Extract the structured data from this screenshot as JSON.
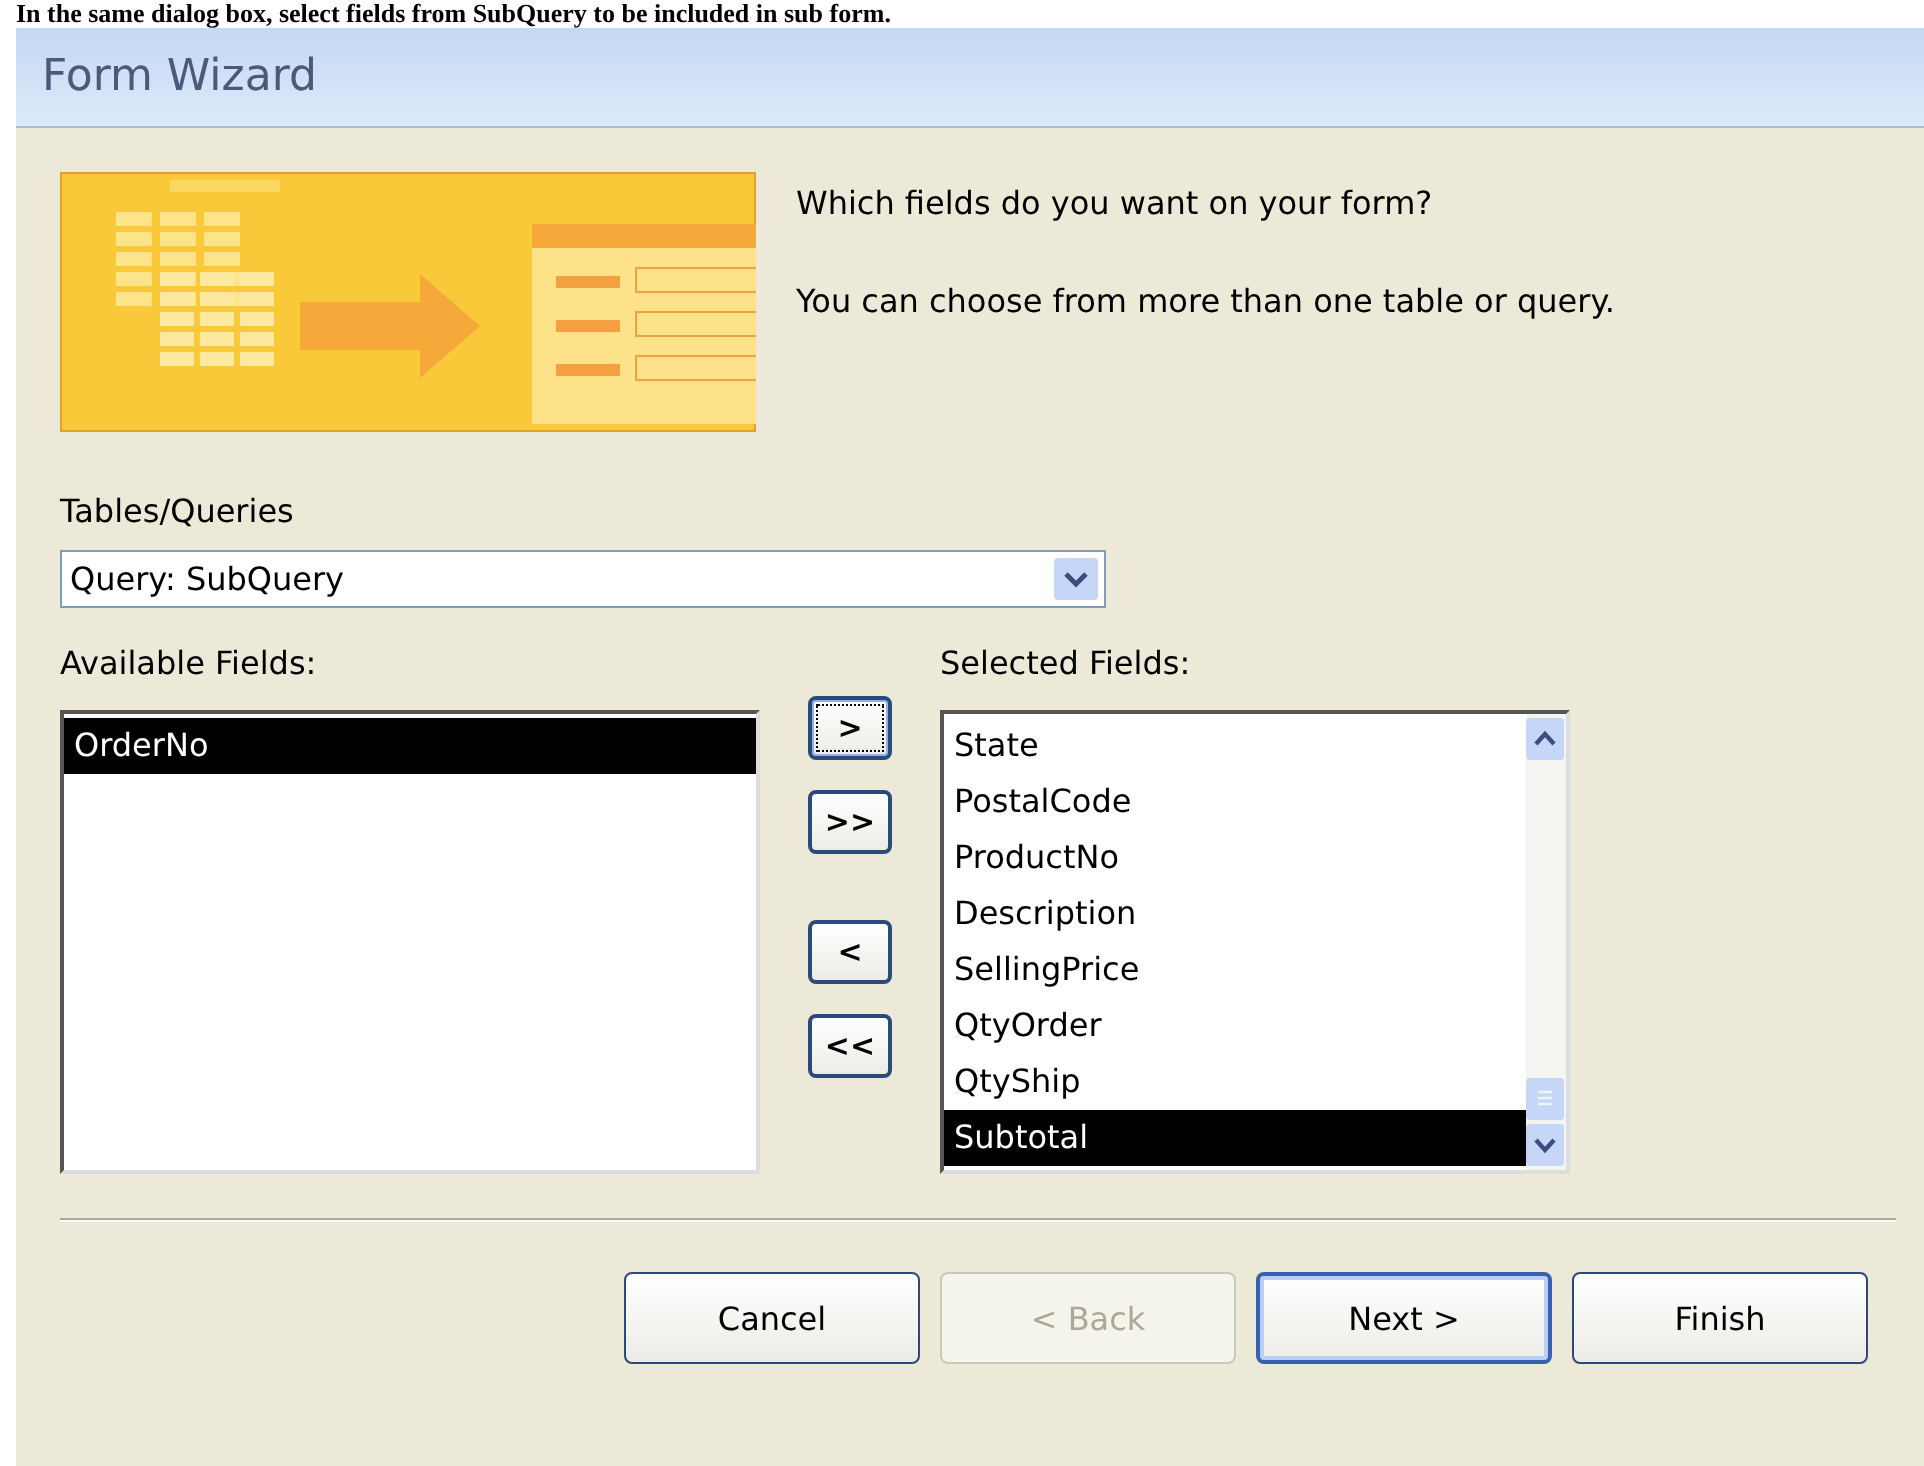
{
  "caption": "In the same dialog box, select fields from SubQuery to be included in sub form.",
  "window": {
    "title": "Form Wizard"
  },
  "intro": [
    "Which fields do you want on your form?",
    "You can choose from more than one table or query."
  ],
  "source": {
    "label": "Tables/Queries",
    "value": "Query: SubQuery"
  },
  "available": {
    "label": "Available Fields:",
    "items": [
      {
        "text": "OrderNo",
        "selected": true
      }
    ]
  },
  "move_buttons": [
    {
      "text": ">",
      "focused": true
    },
    {
      "text": ">>",
      "focused": false
    },
    {
      "text": "<",
      "focused": false
    },
    {
      "text": "<<",
      "focused": false
    }
  ],
  "selected_fields": {
    "label": "Selected Fields:",
    "items": [
      {
        "text": "State",
        "selected": false
      },
      {
        "text": "PostalCode",
        "selected": false
      },
      {
        "text": "ProductNo",
        "selected": false
      },
      {
        "text": "Description",
        "selected": false
      },
      {
        "text": "SellingPrice",
        "selected": false
      },
      {
        "text": "QtyOrder",
        "selected": false
      },
      {
        "text": "QtyShip",
        "selected": false
      },
      {
        "text": "Subtotal",
        "selected": true
      }
    ]
  },
  "buttons": [
    {
      "text": "Cancel",
      "disabled": false,
      "default": false
    },
    {
      "text": "< Back",
      "disabled": true,
      "default": false
    },
    {
      "text": "Next >",
      "disabled": false,
      "default": true
    },
    {
      "text": "Finish",
      "disabled": false,
      "default": false
    }
  ]
}
